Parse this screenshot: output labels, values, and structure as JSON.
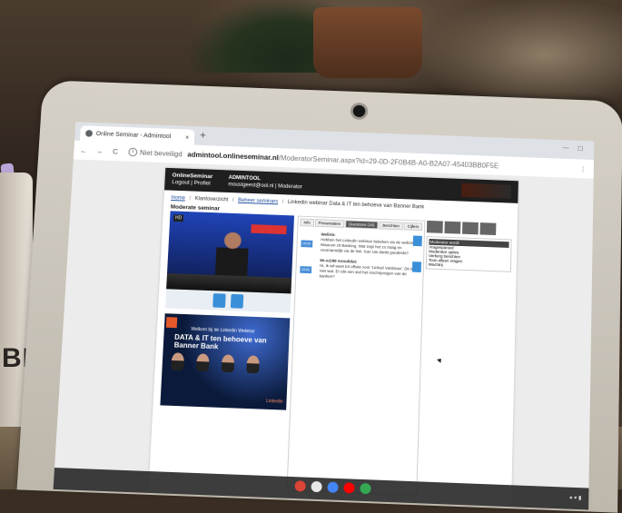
{
  "browser": {
    "tab_title": "Online Seminar - Admintool",
    "tab_close": "×",
    "new_tab": "+",
    "back": "←",
    "forward": "→",
    "reload": "C",
    "security_icon": "i",
    "security_label": "Niet beveiligd",
    "url_host": "admintool.onlineseminar.nl",
    "url_path": "/ModeratorSeminar.aspx?id=29-0D-2F0B4B-A0-B2A07-45403BB0F5E"
  },
  "app": {
    "brand_name": "OnlineSeminar",
    "brand_links": "Logout | Profiel",
    "tool_title": "ADMINTOOL",
    "user_line": "moustgeest@ool.nl | Moderator",
    "breadcrumb": {
      "home": "Home",
      "sep": "/",
      "overview": "Klantoverzicht",
      "seminars": "Beheer seminars",
      "current": "Linkedin webinar Data & IT ten behoeve van Banner Bank"
    },
    "section_title": "Moderate seminar",
    "video_tag": "HD",
    "studio_sign": "Ontmoet",
    "slide": {
      "subtitle": "Welkom bij de Linkedin Webinar",
      "title": "DATA & IT ten behoeve van Banner Bank",
      "brand": "Linkedin"
    },
    "panel_tabs": [
      "Info",
      "Presentaties",
      "Questions (16)",
      "Berichten",
      "Cijfers"
    ],
    "messages": [
      {
        "who": "WellAb:",
        "badge": "09:54",
        "text": "Hebben het Linkedin webinar bekeken via de website. Waarom zit Banking. Wat zegt het zo traag en voornamelijk via de link. Kan Uw dankt goedenkt?"
      },
      {
        "who": "Mr.o@88 Annulidat:",
        "badge": "09:50",
        "text": "Hi, ik wil weet tot offsite voor 'Linked Vanbinas'. Dit in niet wat. Er ebt een stel het inschrijvingen van de banken?"
      }
    ],
    "side_header": "Moderator wordt",
    "side_items": [
      "Vragenpaneel",
      "Moderator opties",
      "Verberg berichten",
      "Toon alleen vragen",
      "Wachtrij"
    ]
  },
  "colors": {
    "header_bg": "#1f1f1f",
    "accent": "#3a8fd9",
    "link": "#1f4e9c"
  },
  "photo": {
    "mug_text": "BR"
  }
}
